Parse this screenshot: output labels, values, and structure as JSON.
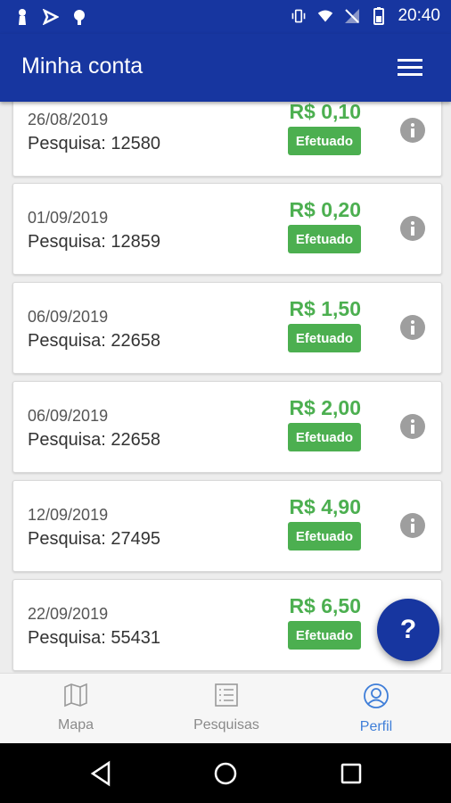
{
  "status_bar": {
    "time": "20:40",
    "left_icons": [
      "notification-icon",
      "location-icon",
      "android-icon"
    ],
    "right_icons": [
      "vibrate-icon",
      "wifi-icon",
      "no-signal-icon",
      "battery-icon"
    ]
  },
  "app_bar": {
    "title": "Minha conta",
    "menu_icon": "hamburger-menu-icon"
  },
  "transactions": [
    {
      "date": "26/08/2019",
      "search": "Pesquisa: 12580",
      "amount": "R$ 0,10",
      "status": "Efetuado"
    },
    {
      "date": "01/09/2019",
      "search": "Pesquisa: 12859",
      "amount": "R$ 0,20",
      "status": "Efetuado"
    },
    {
      "date": "06/09/2019",
      "search": "Pesquisa: 22658",
      "amount": "R$ 1,50",
      "status": "Efetuado"
    },
    {
      "date": "06/09/2019",
      "search": "Pesquisa: 22658",
      "amount": "R$ 2,00",
      "status": "Efetuado"
    },
    {
      "date": "12/09/2019",
      "search": "Pesquisa: 27495",
      "amount": "R$ 4,90",
      "status": "Efetuado"
    },
    {
      "date": "22/09/2019",
      "search": "Pesquisa: 55431",
      "amount": "R$ 6,50",
      "status": "Efetuado"
    }
  ],
  "fab": {
    "label": "?"
  },
  "bottom_nav": [
    {
      "label": "Mapa",
      "icon": "map-icon",
      "active": false
    },
    {
      "label": "Pesquisas",
      "icon": "list-icon",
      "active": false
    },
    {
      "label": "Perfil",
      "icon": "profile-icon",
      "active": true
    }
  ],
  "colors": {
    "primary": "#1736a0",
    "success": "#4caf50",
    "active_nav": "#3f7ed8",
    "info_icon": "#9e9e9e"
  },
  "system_nav": [
    "back-icon",
    "home-icon",
    "recents-icon"
  ]
}
